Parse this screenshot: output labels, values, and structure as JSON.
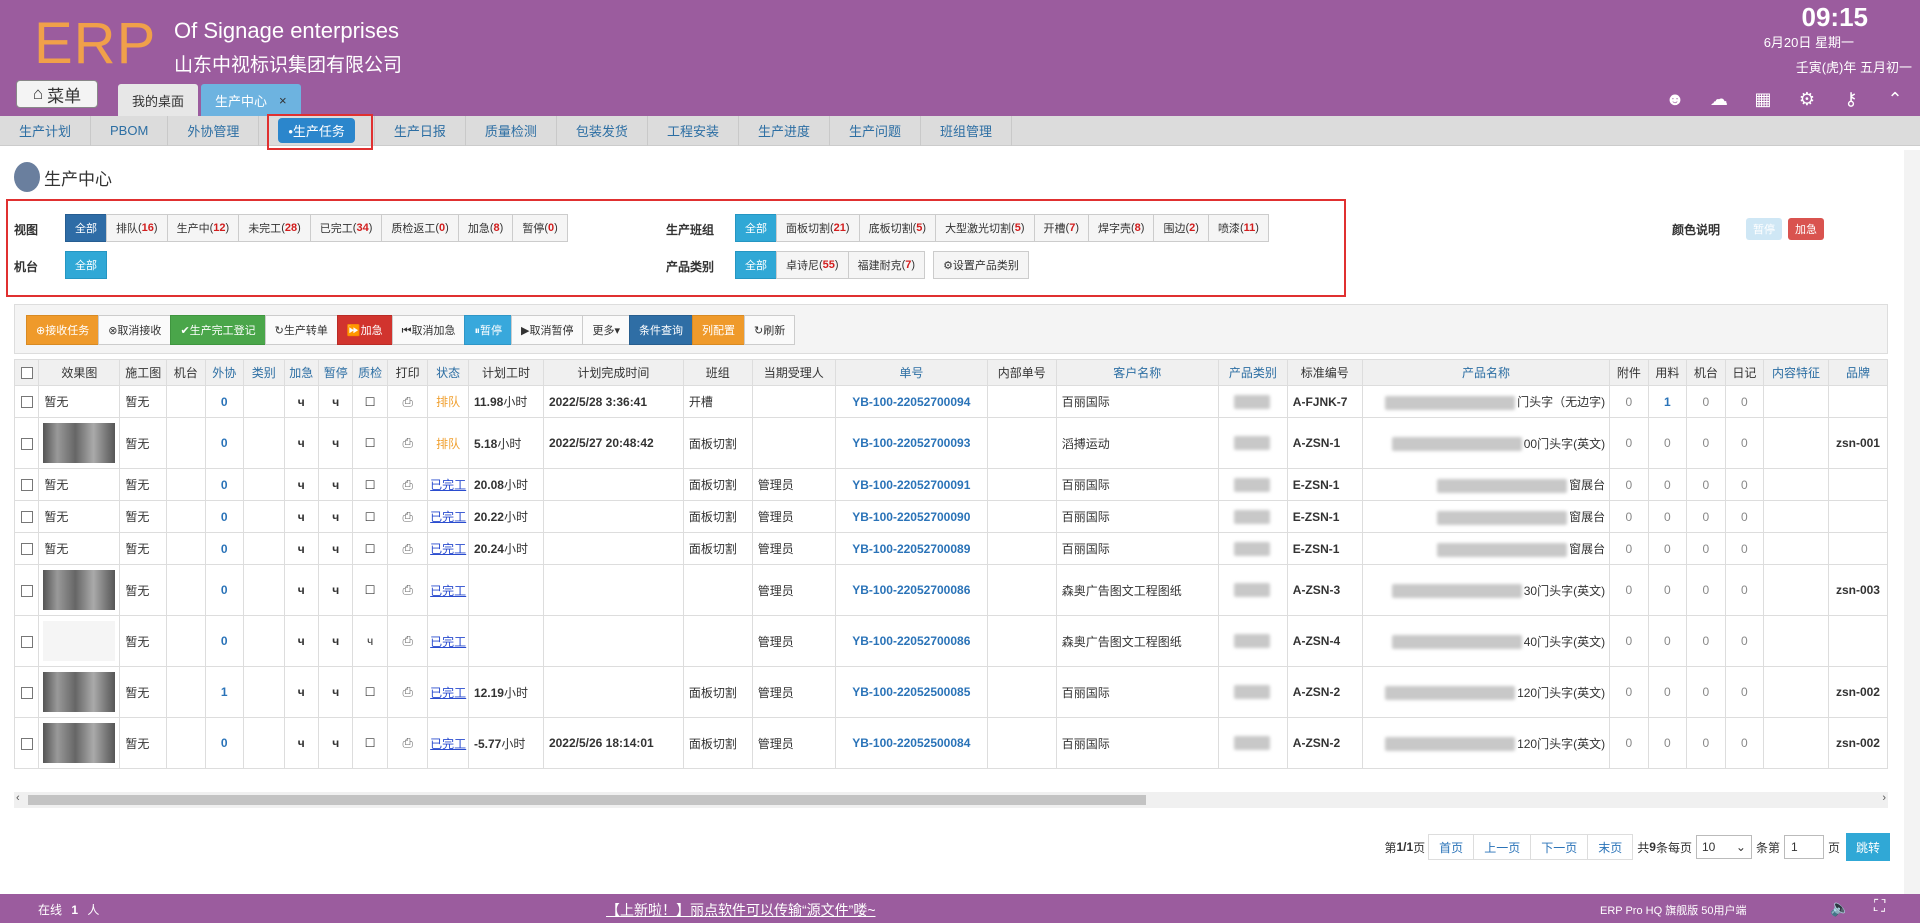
{
  "header": {
    "logo": "ERP",
    "company_en": "Of Signage enterprises",
    "company_cn": "山东中视标识集团有限公司",
    "time": "09:15",
    "date": "6月20日 星期一",
    "lunar": "壬寅(虎)年 五月初一",
    "menu_label": "菜单",
    "tabs": [
      {
        "label": "我的桌面",
        "active": false
      },
      {
        "label": "生产中心",
        "active": true,
        "close": "×"
      }
    ],
    "icons": [
      "user-icon",
      "cloud-upload-icon",
      "apps-icon",
      "gear-icon",
      "key-icon",
      "collapse-icon"
    ]
  },
  "nav": {
    "items": [
      {
        "label": "生产计划"
      },
      {
        "label": "PBOM"
      },
      {
        "label": "外协管理"
      },
      {
        "label": "•生产任务",
        "active": true
      },
      {
        "label": "生产日报"
      },
      {
        "label": "质量检测"
      },
      {
        "label": "包装发货"
      },
      {
        "label": "工程安装"
      },
      {
        "label": "生产进度"
      },
      {
        "label": "生产问题"
      },
      {
        "label": "班组管理"
      }
    ]
  },
  "page": {
    "title": "生产中心"
  },
  "filters": {
    "view_label": "视图",
    "view": [
      {
        "label": "全部",
        "count": "",
        "active": true
      },
      {
        "label": "排队",
        "count": "16"
      },
      {
        "label": "生产中",
        "count": "12"
      },
      {
        "label": "未完工",
        "count": "28"
      },
      {
        "label": "已完工",
        "count": "34"
      },
      {
        "label": "质检返工",
        "count": "0"
      },
      {
        "label": "加急",
        "count": "8"
      },
      {
        "label": "暂停",
        "count": "0"
      }
    ],
    "machine_label": "机台",
    "machine": [
      {
        "label": "全部",
        "active": true
      }
    ],
    "team_label": "生产班组",
    "team": [
      {
        "label": "全部",
        "count": "",
        "active": true
      },
      {
        "label": "面板切割",
        "count": "21"
      },
      {
        "label": "底板切割",
        "count": "5"
      },
      {
        "label": "大型激光切割",
        "count": "5"
      },
      {
        "label": "开槽",
        "count": "7"
      },
      {
        "label": "焊字壳",
        "count": "8"
      },
      {
        "label": "围边",
        "count": "2"
      },
      {
        "label": "喷漆",
        "count": "11"
      }
    ],
    "category_label": "产品类别",
    "category": [
      {
        "label": "全部",
        "count": "",
        "active": true
      },
      {
        "label": "卓诗尼",
        "count": "55"
      },
      {
        "label": "福建耐克",
        "count": "7"
      }
    ],
    "set_category": "⚙设置产品类别",
    "color_label": "颜色说明",
    "color_items": [
      {
        "label": "暂停",
        "color": "#cfe7f5"
      },
      {
        "label": "加急",
        "color": "#d9534f"
      }
    ]
  },
  "toolbar": {
    "buttons": [
      {
        "label": "⊕接收任务",
        "style": "orange"
      },
      {
        "label": "⊗取消接收",
        "style": ""
      },
      {
        "label": "✔生产完工登记",
        "style": "green"
      },
      {
        "label": "↻生产转单",
        "style": ""
      },
      {
        "label": "⏩加急",
        "style": "red"
      },
      {
        "label": "⏮取消加急",
        "style": ""
      },
      {
        "label": "⏸暂停",
        "style": "sky"
      },
      {
        "label": "▶取消暂停",
        "style": ""
      },
      {
        "label": "更多▾",
        "style": ""
      },
      {
        "label": "条件查询",
        "style": "navy"
      },
      {
        "label": "列配置",
        "style": "orange"
      },
      {
        "label": "↻刷新",
        "style": ""
      }
    ]
  },
  "table": {
    "columns": [
      "",
      "效果图",
      "施工图",
      "机台",
      "外协",
      "类别",
      "加急",
      "暂停",
      "质检",
      "打印",
      "状态",
      "计划工时",
      "计划完成时间",
      "班组",
      "当期受理人",
      "单号",
      "内部单号",
      "客户名称",
      "产品类别",
      "标准编号",
      "产品名称",
      "附件",
      "用料",
      "机台",
      "日记",
      "内容特征",
      "品牌"
    ],
    "rows": [
      {
        "thumb": "none",
        "construction": "暂无",
        "outsource": "0",
        "urgent": "ч",
        "pause": "ч",
        "qc": "☐",
        "status": "排队",
        "hours": "11.98",
        "hours_unit": "小时",
        "finish": "2022/5/28 3:36:41",
        "team": "开槽",
        "assignee": "",
        "order": "YB-100-22052700094",
        "customer": "百丽国际",
        "std": "A-FJNK-7",
        "product": "门头字（无边字)",
        "att": "0",
        "mat": "1",
        "mach": "0",
        "diary": "0",
        "brand": "",
        "tall": false
      },
      {
        "thumb": "dark",
        "construction": "暂无",
        "outsource": "0",
        "urgent": "ч",
        "pause": "ч",
        "qc": "☐",
        "status": "排队",
        "hours": "5.18",
        "hours_unit": "小时",
        "finish": "2022/5/27 20:48:42",
        "team": "面板切割",
        "assignee": "",
        "order": "YB-100-22052700093",
        "customer": "滔搏运动",
        "std": "A-ZSN-1",
        "product": "00门头字(英文)",
        "att": "0",
        "mat": "0",
        "mach": "0",
        "diary": "0",
        "brand": "zsn-001",
        "tall": true
      },
      {
        "thumb": "none",
        "construction": "暂无",
        "outsource": "0",
        "urgent": "ч",
        "pause": "ч",
        "qc": "☐",
        "status": "已完工",
        "hours": "20.08",
        "hours_unit": "小时",
        "finish": "",
        "team": "面板切割",
        "assignee": "管理员",
        "order": "YB-100-22052700091",
        "customer": "百丽国际",
        "std": "E-ZSN-1",
        "product": "窗展台",
        "att": "0",
        "mat": "0",
        "mach": "0",
        "diary": "0",
        "brand": "",
        "tall": false
      },
      {
        "thumb": "none",
        "construction": "暂无",
        "outsource": "0",
        "urgent": "ч",
        "pause": "ч",
        "qc": "☐",
        "status": "已完工",
        "hours": "20.22",
        "hours_unit": "小时",
        "finish": "",
        "team": "面板切割",
        "assignee": "管理员",
        "order": "YB-100-22052700090",
        "customer": "百丽国际",
        "std": "E-ZSN-1",
        "product": "窗展台",
        "att": "0",
        "mat": "0",
        "mach": "0",
        "diary": "0",
        "brand": "",
        "tall": false
      },
      {
        "thumb": "none",
        "construction": "暂无",
        "outsource": "0",
        "urgent": "ч",
        "pause": "ч",
        "qc": "☐",
        "status": "已完工",
        "hours": "20.24",
        "hours_unit": "小时",
        "finish": "",
        "team": "面板切割",
        "assignee": "管理员",
        "order": "YB-100-22052700089",
        "customer": "百丽国际",
        "std": "E-ZSN-1",
        "product": "窗展台",
        "att": "0",
        "mat": "0",
        "mach": "0",
        "diary": "0",
        "brand": "",
        "tall": false
      },
      {
        "thumb": "dark",
        "construction": "暂无",
        "outsource": "0",
        "urgent": "ч",
        "pause": "ч",
        "qc": "☐",
        "status": "已完工",
        "hours": "",
        "hours_unit": "",
        "finish": "",
        "team": "",
        "assignee": "管理员",
        "order": "YB-100-22052700086",
        "customer": "森奥广告图文工程图纸",
        "std": "A-ZSN-3",
        "product": "30门头字(英文)",
        "att": "0",
        "mat": "0",
        "mach": "0",
        "diary": "0",
        "brand": "zsn-003",
        "tall": true
      },
      {
        "thumb": "light",
        "construction": "暂无",
        "outsource": "0",
        "urgent": "ч",
        "pause": "ч",
        "qc": "ч",
        "status": "已完工",
        "hours": "",
        "hours_unit": "",
        "finish": "",
        "team": "",
        "assignee": "管理员",
        "order": "YB-100-22052700086",
        "customer": "森奥广告图文工程图纸",
        "std": "A-ZSN-4",
        "product": "40门头字(英文)",
        "att": "0",
        "mat": "0",
        "mach": "0",
        "diary": "0",
        "brand": "",
        "tall": true
      },
      {
        "thumb": "dark",
        "construction": "暂无",
        "outsource": "1",
        "urgent": "ч",
        "pause": "ч",
        "qc": "☐",
        "status": "已完工",
        "hours": "12.19",
        "hours_unit": "小时",
        "finish": "",
        "team": "面板切割",
        "assignee": "管理员",
        "order": "YB-100-22052500085",
        "customer": "百丽国际",
        "std": "A-ZSN-2",
        "product": "120门头字(英文)",
        "att": "0",
        "mat": "0",
        "mach": "0",
        "diary": "0",
        "brand": "zsn-002",
        "tall": true
      },
      {
        "thumb": "dark",
        "construction": "暂无",
        "outsource": "0",
        "urgent": "ч",
        "pause": "ч",
        "qc": "☐",
        "status": "已完工",
        "hours": "-5.77",
        "hours_unit": "小时",
        "finish": "2022/5/26 18:14:01",
        "team": "面板切割",
        "assignee": "管理员",
        "order": "YB-100-22052500084",
        "customer": "百丽国际",
        "std": "A-ZSN-2",
        "product": "120门头字(英文)",
        "att": "0",
        "mat": "0",
        "mach": "0",
        "diary": "0",
        "brand": "zsn-002",
        "tall": true
      }
    ]
  },
  "pager": {
    "page_info_prefix": "第",
    "page_info": "1/1",
    "page_info_suffix": "页",
    "first": "首页",
    "prev": "上一页",
    "next": "下一页",
    "last": "末页",
    "total_prefix": "共",
    "total": "9",
    "total_suffix": "条每页",
    "per_page": "10",
    "per_page_suffix": "条第",
    "goto_page": "1",
    "goto_suffix": "页",
    "jump": "跳转"
  },
  "footer": {
    "online_label": "在线",
    "online_count": "1",
    "online_unit": "人",
    "announcement": "【上新啦！】丽点软件可以传输“源文件”喽~",
    "version": "ERP Pro HQ 旗舰版 50用户端"
  }
}
